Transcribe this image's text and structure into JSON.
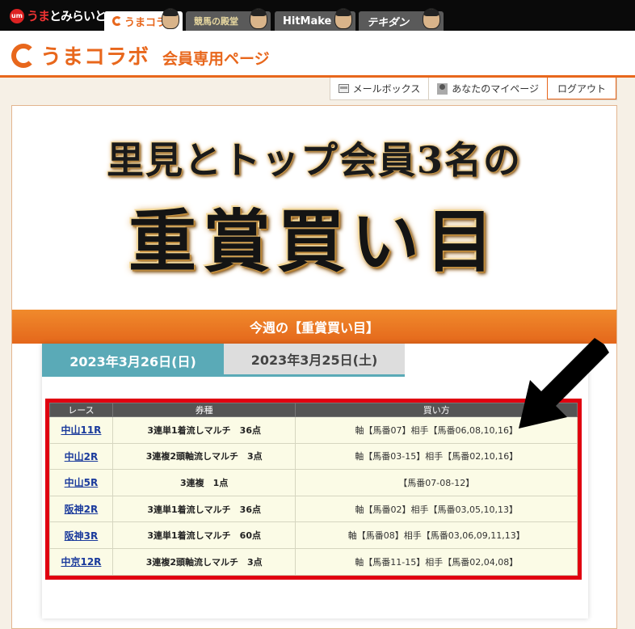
{
  "topbar": {
    "mirai_badge": "um",
    "mirai_prefix": "うま",
    "mirai_suffix": "とみらいと",
    "tabs": [
      {
        "label": "うまコラボ"
      },
      {
        "label": "競馬の殿堂"
      },
      {
        "label": "HitMake"
      },
      {
        "label": "テキダン"
      }
    ]
  },
  "header": {
    "logo": "うまコラボ",
    "subtitle": "会員専用ページ"
  },
  "utilnav": {
    "mailbox": "メールボックス",
    "mypage": "あなたのマイページ",
    "logout": "ログアウト"
  },
  "hero": {
    "line1": "里見とトップ会員3名の",
    "line2": "重賞買い目"
  },
  "week_banner": "今週の【重賞買い目】",
  "date_tabs": [
    "2023年3月26日(日)",
    "2023年3月25日(土)"
  ],
  "table": {
    "headers": [
      "レース",
      "券種",
      "買い方"
    ],
    "rows": [
      [
        "中山11R",
        "3連単1着流しマルチ　36点",
        "軸【馬番07】相手【馬番06,08,10,16】"
      ],
      [
        "中山2R",
        "3連複2頭軸流しマルチ　3点",
        "軸【馬番03-15】相手【馬番02,10,16】"
      ],
      [
        "中山5R",
        "3連複　1点",
        "【馬番07-08-12】"
      ],
      [
        "阪神2R",
        "3連単1着流しマルチ　36点",
        "軸【馬番02】相手【馬番03,05,10,13】"
      ],
      [
        "阪神3R",
        "3連単1着流しマルチ　60点",
        "軸【馬番08】相手【馬番03,06,09,11,13】"
      ],
      [
        "中京12R",
        "3連複2頭軸流しマルチ　3点",
        "軸【馬番11-15】相手【馬番02,04,08】"
      ]
    ]
  },
  "colors": {
    "accent": "#e8671c",
    "tab_active": "#5aaab7",
    "table_border": "#e00010"
  }
}
